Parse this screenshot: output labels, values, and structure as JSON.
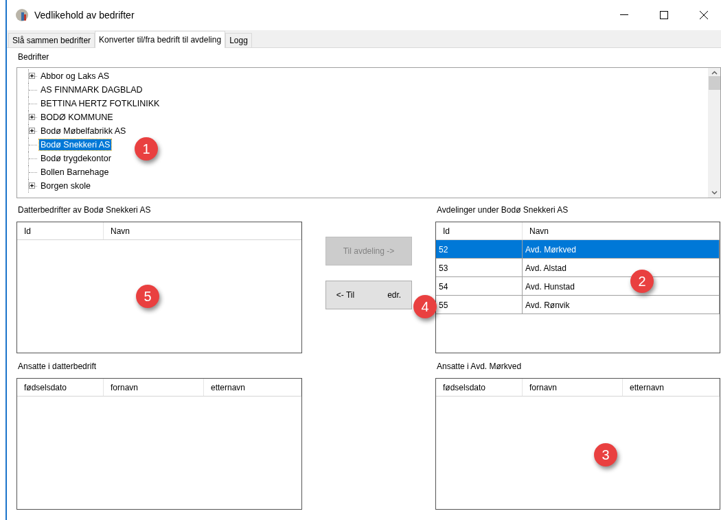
{
  "window": {
    "title": "Vedlikehold av bedrifter"
  },
  "tabs": [
    {
      "label": "Slå sammen bedrifter",
      "selected": false
    },
    {
      "label": "Konverter til/fra bedrift til avdeling",
      "selected": true
    },
    {
      "label": "Logg",
      "selected": false
    }
  ],
  "tree": {
    "label": "Bedrifter",
    "items": [
      {
        "text": "Abbor og Laks AS",
        "expandable": true,
        "selected": false
      },
      {
        "text": "AS FINNMARK DAGBLAD",
        "expandable": false,
        "selected": false
      },
      {
        "text": "BETTINA HERTZ FOTKLINIKK",
        "expandable": false,
        "selected": false
      },
      {
        "text": "BODØ KOMMUNE",
        "expandable": true,
        "selected": false
      },
      {
        "text": "Bodø Møbelfabrikk AS",
        "expandable": true,
        "selected": false
      },
      {
        "text": "Bodø Snekkeri AS",
        "expandable": false,
        "selected": true
      },
      {
        "text": "Bodø trygdekontor",
        "expandable": false,
        "selected": false
      },
      {
        "text": "Bollen Barnehage",
        "expandable": false,
        "selected": false
      },
      {
        "text": "Borgen skole",
        "expandable": true,
        "selected": false
      }
    ]
  },
  "left": {
    "list_label": "Datterbedrifter av Bodø Snekkeri AS",
    "list_columns": [
      "Id",
      "Navn"
    ],
    "employees_label": "Ansatte i datterbedrift",
    "employee_columns": [
      "fødselsdato",
      "fornavn",
      "etternavn"
    ]
  },
  "buttons": [
    {
      "label_parts": [
        "Til avdeling ->"
      ],
      "disabled": true
    },
    {
      "label_parts": [
        "<- Til",
        "edr."
      ],
      "disabled": false
    }
  ],
  "right": {
    "list_label": "Avdelinger under Bodø Snekkeri AS",
    "list_columns": [
      "Id",
      "Navn"
    ],
    "rows": [
      {
        "id": "52",
        "name": "Avd. Mørkved",
        "selected": true
      },
      {
        "id": "53",
        "name": "Avd. Alstad",
        "selected": false
      },
      {
        "id": "54",
        "name": "Avd. Hunstad",
        "selected": false
      },
      {
        "id": "55",
        "name": "Avd. Rønvik",
        "selected": false
      }
    ],
    "employees_label": "Ansatte i Avd. Mørkved",
    "employee_columns": [
      "fødselsdato",
      "fornavn",
      "etternavn"
    ]
  },
  "callouts": [
    "1",
    "2",
    "3",
    "4",
    "5"
  ]
}
